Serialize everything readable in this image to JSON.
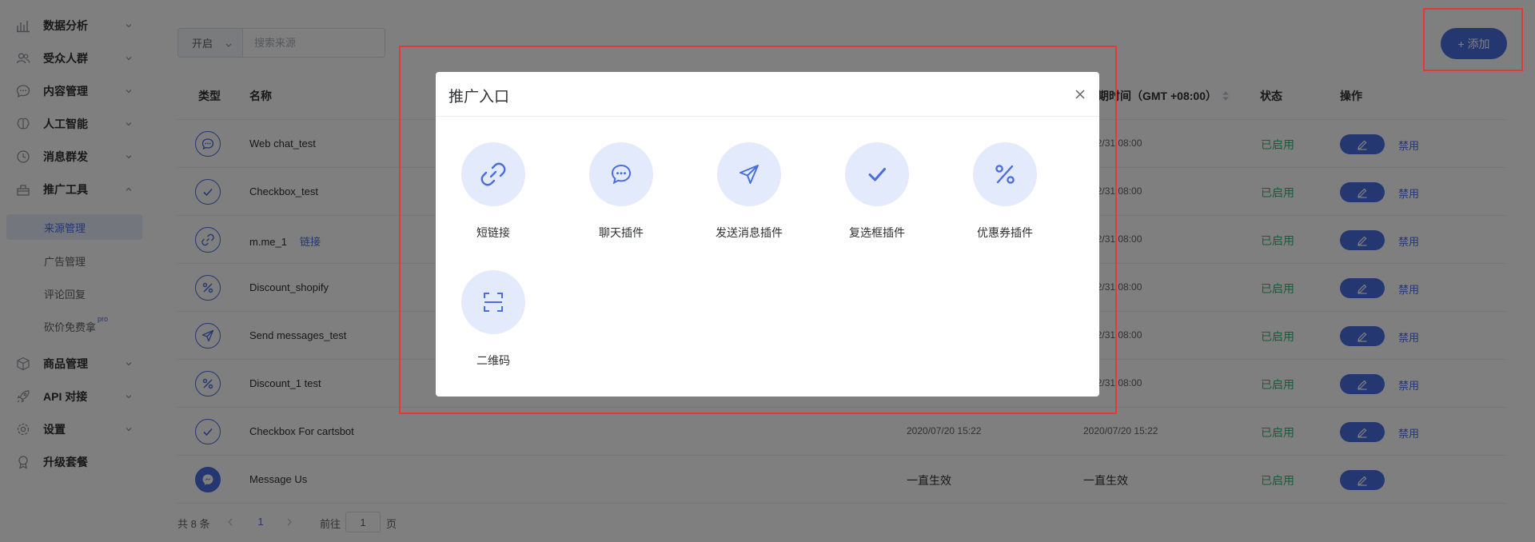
{
  "colors": {
    "accent": "#4a6ee0",
    "status_green": "#2eb872",
    "highlight_red": "#e53935",
    "modal_icon_bg": "#e3eafc"
  },
  "sidebar": {
    "items": [
      {
        "label": "数据分析",
        "icon": "bar-chart-icon"
      },
      {
        "label": "受众人群",
        "icon": "users-icon"
      },
      {
        "label": "内容管理",
        "icon": "chat-bubble-icon"
      },
      {
        "label": "人工智能",
        "icon": "brain-icon"
      },
      {
        "label": "消息群发",
        "icon": "clock-icon"
      },
      {
        "label": "推广工具",
        "icon": "tools-icon"
      },
      {
        "label": "商品管理",
        "icon": "box-icon"
      },
      {
        "label": "API 对接",
        "icon": "rocket-icon"
      },
      {
        "label": "设置",
        "icon": "gear-icon"
      },
      {
        "label": "升级套餐",
        "icon": "medal-icon"
      }
    ],
    "sub_items": [
      {
        "label": "来源管理"
      },
      {
        "label": "广告管理"
      },
      {
        "label": "评论回复"
      },
      {
        "label": "砍价免费拿",
        "sup": "pro"
      }
    ]
  },
  "filter": {
    "select_value": "开启",
    "search_placeholder": "搜索来源"
  },
  "add_button": "+ 添加",
  "table": {
    "headers": {
      "type": "类型",
      "name": "名称",
      "expire": "期时间（GMT +08:00）",
      "status": "状态",
      "actions": "操作"
    },
    "rows": [
      {
        "icon": "chat-icon",
        "name": "Web chat_test",
        "t1": "",
        "t2": "9/12/31 08:00",
        "status": "已启用",
        "disable": "禁用"
      },
      {
        "icon": "check-icon",
        "name": "Checkbox_test",
        "t1": "",
        "t2": "9/12/31 08:00",
        "status": "已启用",
        "disable": "禁用"
      },
      {
        "icon": "link-icon",
        "name": "m.me_1",
        "link": "链接",
        "t1": "",
        "t2": "9/12/31 08:00",
        "status": "已启用",
        "disable": "禁用"
      },
      {
        "icon": "percent-icon",
        "name": "Discount_shopify",
        "t1": "",
        "t2": "9/12/31 08:00",
        "status": "已启用",
        "disable": "禁用"
      },
      {
        "icon": "send-icon",
        "name": "Send messages_test",
        "t1": "",
        "t2": "9/12/31 08:00",
        "status": "已启用",
        "disable": "禁用"
      },
      {
        "icon": "percent-icon",
        "name": "Discount_1 test",
        "t1": "",
        "t2": "9/12/31 08:00",
        "status": "已启用",
        "disable": "禁用"
      },
      {
        "icon": "check-icon",
        "name": "Checkbox For cartsbot",
        "t1": "2020/07/20 15:22",
        "t2": "2020/07/20 15:22",
        "status": "已启用",
        "disable": "禁用"
      },
      {
        "icon": "messenger-icon",
        "name": "Message Us",
        "t1": "一直生效",
        "t2": "一直生效",
        "status": "已启用",
        "disable": ""
      }
    ]
  },
  "pagination": {
    "total": "共 8 条",
    "current_page": "1",
    "goto_label": "前往",
    "goto_value": "1",
    "page_suffix": "页"
  },
  "modal": {
    "title": "推广入口",
    "entries": [
      {
        "label": "短链接",
        "icon": "link-icon"
      },
      {
        "label": "聊天插件",
        "icon": "chat-icon"
      },
      {
        "label": "发送消息插件",
        "icon": "send-icon"
      },
      {
        "label": "复选框插件",
        "icon": "check-icon"
      },
      {
        "label": "优惠券插件",
        "icon": "percent-icon"
      },
      {
        "label": "二维码",
        "icon": "scan-icon"
      }
    ]
  }
}
